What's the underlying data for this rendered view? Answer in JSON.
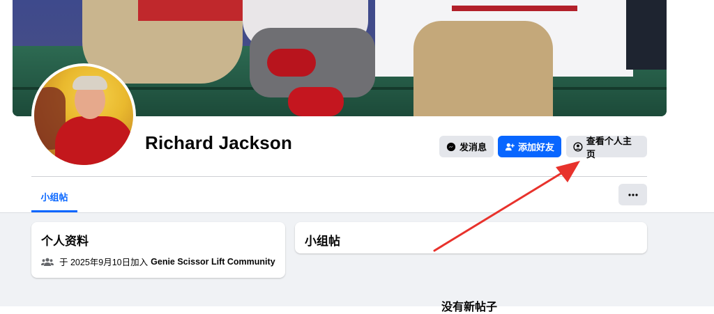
{
  "profile": {
    "name": "Richard Jackson"
  },
  "actions": {
    "message_label": "发消息",
    "add_friend_label": "添加好友",
    "view_profile_label": "查看个人主页"
  },
  "tabs": [
    {
      "label": "小组帖",
      "active": true
    }
  ],
  "about_card": {
    "title": "个人资料",
    "joined_prefix": "于 2025年9月10日加入",
    "group_name": "Genie Scissor Lift Community"
  },
  "posts_card": {
    "title": "小组帖",
    "empty_text": "没有新帖子"
  },
  "icons": {
    "message": "messenger-icon",
    "add_friend": "add-friend-icon",
    "view_profile": "profile-circle-icon",
    "more": "more-dots-icon",
    "group": "group-icon"
  },
  "colors": {
    "accent": "#0866ff",
    "annotation_arrow": "#e8322c",
    "button_gray": "#e4e6eb",
    "page_bg": "#f0f2f5"
  }
}
